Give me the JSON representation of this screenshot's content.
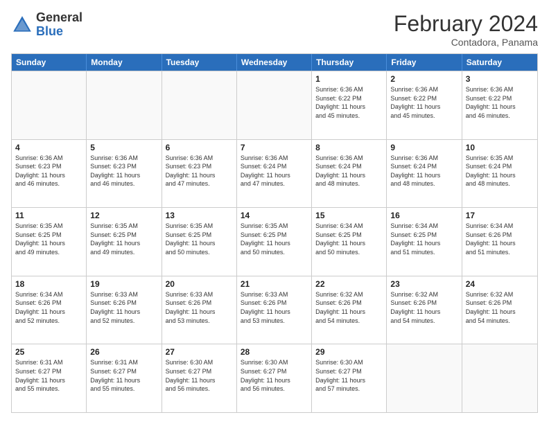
{
  "header": {
    "logo_general": "General",
    "logo_blue": "Blue",
    "month_title": "February 2024",
    "location": "Contadora, Panama"
  },
  "days_of_week": [
    "Sunday",
    "Monday",
    "Tuesday",
    "Wednesday",
    "Thursday",
    "Friday",
    "Saturday"
  ],
  "weeks": [
    [
      {
        "day": "",
        "info": ""
      },
      {
        "day": "",
        "info": ""
      },
      {
        "day": "",
        "info": ""
      },
      {
        "day": "",
        "info": ""
      },
      {
        "day": "1",
        "info": "Sunrise: 6:36 AM\nSunset: 6:22 PM\nDaylight: 11 hours\nand 45 minutes."
      },
      {
        "day": "2",
        "info": "Sunrise: 6:36 AM\nSunset: 6:22 PM\nDaylight: 11 hours\nand 45 minutes."
      },
      {
        "day": "3",
        "info": "Sunrise: 6:36 AM\nSunset: 6:22 PM\nDaylight: 11 hours\nand 46 minutes."
      }
    ],
    [
      {
        "day": "4",
        "info": "Sunrise: 6:36 AM\nSunset: 6:23 PM\nDaylight: 11 hours\nand 46 minutes."
      },
      {
        "day": "5",
        "info": "Sunrise: 6:36 AM\nSunset: 6:23 PM\nDaylight: 11 hours\nand 46 minutes."
      },
      {
        "day": "6",
        "info": "Sunrise: 6:36 AM\nSunset: 6:23 PM\nDaylight: 11 hours\nand 47 minutes."
      },
      {
        "day": "7",
        "info": "Sunrise: 6:36 AM\nSunset: 6:24 PM\nDaylight: 11 hours\nand 47 minutes."
      },
      {
        "day": "8",
        "info": "Sunrise: 6:36 AM\nSunset: 6:24 PM\nDaylight: 11 hours\nand 48 minutes."
      },
      {
        "day": "9",
        "info": "Sunrise: 6:36 AM\nSunset: 6:24 PM\nDaylight: 11 hours\nand 48 minutes."
      },
      {
        "day": "10",
        "info": "Sunrise: 6:35 AM\nSunset: 6:24 PM\nDaylight: 11 hours\nand 48 minutes."
      }
    ],
    [
      {
        "day": "11",
        "info": "Sunrise: 6:35 AM\nSunset: 6:25 PM\nDaylight: 11 hours\nand 49 minutes."
      },
      {
        "day": "12",
        "info": "Sunrise: 6:35 AM\nSunset: 6:25 PM\nDaylight: 11 hours\nand 49 minutes."
      },
      {
        "day": "13",
        "info": "Sunrise: 6:35 AM\nSunset: 6:25 PM\nDaylight: 11 hours\nand 50 minutes."
      },
      {
        "day": "14",
        "info": "Sunrise: 6:35 AM\nSunset: 6:25 PM\nDaylight: 11 hours\nand 50 minutes."
      },
      {
        "day": "15",
        "info": "Sunrise: 6:34 AM\nSunset: 6:25 PM\nDaylight: 11 hours\nand 50 minutes."
      },
      {
        "day": "16",
        "info": "Sunrise: 6:34 AM\nSunset: 6:25 PM\nDaylight: 11 hours\nand 51 minutes."
      },
      {
        "day": "17",
        "info": "Sunrise: 6:34 AM\nSunset: 6:26 PM\nDaylight: 11 hours\nand 51 minutes."
      }
    ],
    [
      {
        "day": "18",
        "info": "Sunrise: 6:34 AM\nSunset: 6:26 PM\nDaylight: 11 hours\nand 52 minutes."
      },
      {
        "day": "19",
        "info": "Sunrise: 6:33 AM\nSunset: 6:26 PM\nDaylight: 11 hours\nand 52 minutes."
      },
      {
        "day": "20",
        "info": "Sunrise: 6:33 AM\nSunset: 6:26 PM\nDaylight: 11 hours\nand 53 minutes."
      },
      {
        "day": "21",
        "info": "Sunrise: 6:33 AM\nSunset: 6:26 PM\nDaylight: 11 hours\nand 53 minutes."
      },
      {
        "day": "22",
        "info": "Sunrise: 6:32 AM\nSunset: 6:26 PM\nDaylight: 11 hours\nand 54 minutes."
      },
      {
        "day": "23",
        "info": "Sunrise: 6:32 AM\nSunset: 6:26 PM\nDaylight: 11 hours\nand 54 minutes."
      },
      {
        "day": "24",
        "info": "Sunrise: 6:32 AM\nSunset: 6:26 PM\nDaylight: 11 hours\nand 54 minutes."
      }
    ],
    [
      {
        "day": "25",
        "info": "Sunrise: 6:31 AM\nSunset: 6:27 PM\nDaylight: 11 hours\nand 55 minutes."
      },
      {
        "day": "26",
        "info": "Sunrise: 6:31 AM\nSunset: 6:27 PM\nDaylight: 11 hours\nand 55 minutes."
      },
      {
        "day": "27",
        "info": "Sunrise: 6:30 AM\nSunset: 6:27 PM\nDaylight: 11 hours\nand 56 minutes."
      },
      {
        "day": "28",
        "info": "Sunrise: 6:30 AM\nSunset: 6:27 PM\nDaylight: 11 hours\nand 56 minutes."
      },
      {
        "day": "29",
        "info": "Sunrise: 6:30 AM\nSunset: 6:27 PM\nDaylight: 11 hours\nand 57 minutes."
      },
      {
        "day": "",
        "info": ""
      },
      {
        "day": "",
        "info": ""
      }
    ]
  ]
}
